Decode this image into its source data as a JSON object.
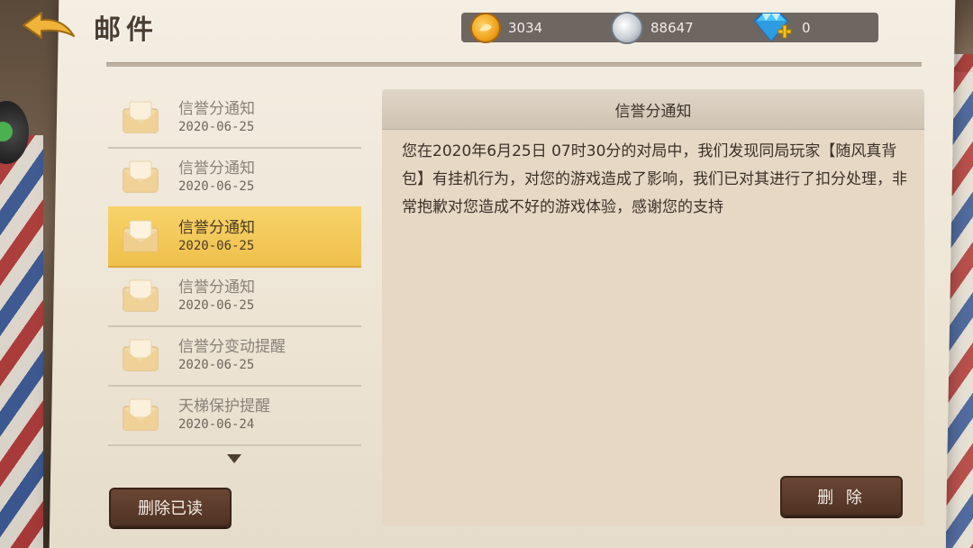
{
  "header": {
    "title": "邮件",
    "currencies": {
      "gold": "3034",
      "silver": "88647",
      "diamond": "0"
    }
  },
  "mail_list": {
    "items": [
      {
        "title": "信誉分通知",
        "date": "2020-06-25",
        "selected": false
      },
      {
        "title": "信誉分通知",
        "date": "2020-06-25",
        "selected": false
      },
      {
        "title": "信誉分通知",
        "date": "2020-06-25",
        "selected": true
      },
      {
        "title": "信誉分通知",
        "date": "2020-06-25",
        "selected": false
      },
      {
        "title": "信誉分变动提醒",
        "date": "2020-06-25",
        "selected": false
      },
      {
        "title": "天梯保护提醒",
        "date": "2020-06-24",
        "selected": false
      }
    ],
    "delete_read_label": "删除已读"
  },
  "detail": {
    "title": "信誉分通知",
    "body": "您在2020年6月25日 07时30分的对局中，我们发现同局玩家【随风真背包】有挂机行为，对您的游戏造成了影响，我们已对其进行了扣分处理，非常抱歉对您造成不好的游戏体验，感谢您的支持",
    "delete_label": "删 除"
  },
  "colors": {
    "selected_row": "#f2c655",
    "button_dark": "#5a3a2a",
    "currency_bar": "#6e6660"
  }
}
